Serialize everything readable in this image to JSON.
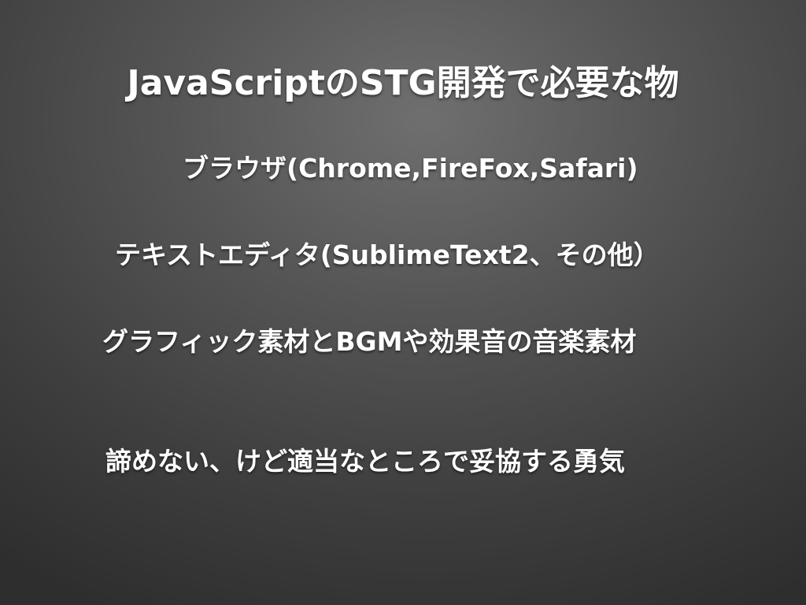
{
  "slide": {
    "title": "JavaScriptのSTG開発で必要な物",
    "items": [
      "ブラウザ(Chrome,FireFox,Safari)",
      "テキストエディタ(SublimeText2、その他）",
      "グラフィック素材とBGMや効果音の音楽素材",
      "諦めない、けど適当なところで妥協する勇気"
    ]
  },
  "colors": {
    "background_center": "#6f6f6f",
    "background_edge": "#2e2e2e",
    "text": "#ffffff"
  }
}
